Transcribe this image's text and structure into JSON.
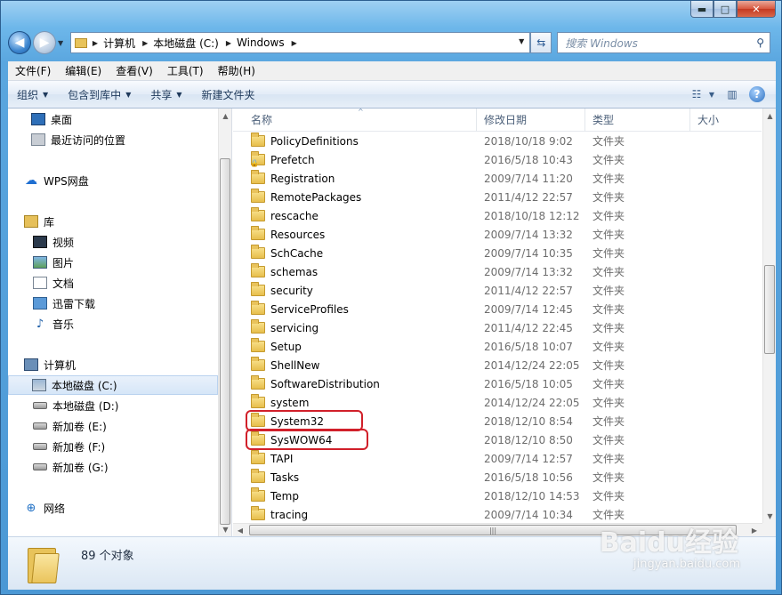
{
  "caption": {
    "minimize": "▬",
    "maximize": "□",
    "close": "✕"
  },
  "address": {
    "crumbs": [
      "计算机",
      "本地磁盘 (C:)",
      "Windows"
    ]
  },
  "search": {
    "placeholder": "搜索 Windows"
  },
  "menu": [
    "文件(F)",
    "编辑(E)",
    "查看(V)",
    "工具(T)",
    "帮助(H)"
  ],
  "toolbar": {
    "organize": "组织",
    "include_library": "包含到库中",
    "share": "共享",
    "new_folder": "新建文件夹"
  },
  "nav": {
    "desktop": "桌面",
    "recent": "最近访问的位置",
    "wps_cloud": "WPS网盘",
    "libraries": "库",
    "videos": "视频",
    "pictures": "图片",
    "documents": "文档",
    "thunder_downloads": "迅雷下载",
    "music": "音乐",
    "computer": "计算机",
    "drive_c": "本地磁盘 (C:)",
    "drive_d": "本地磁盘 (D:)",
    "drive_e": "新加卷 (E:)",
    "drive_f": "新加卷 (F:)",
    "drive_g": "新加卷 (G:)",
    "network": "网络"
  },
  "columns": {
    "name": "名称",
    "date": "修改日期",
    "type": "类型",
    "size": "大小"
  },
  "files": [
    {
      "name": "PolicyDefinitions",
      "date": "2018/10/18 9:02",
      "type": "文件夹"
    },
    {
      "name": "Prefetch",
      "date": "2016/5/18 10:43",
      "type": "文件夹",
      "locked": true
    },
    {
      "name": "Registration",
      "date": "2009/7/14 11:20",
      "type": "文件夹"
    },
    {
      "name": "RemotePackages",
      "date": "2011/4/12 22:57",
      "type": "文件夹"
    },
    {
      "name": "rescache",
      "date": "2018/10/18 12:12",
      "type": "文件夹"
    },
    {
      "name": "Resources",
      "date": "2009/7/14 13:32",
      "type": "文件夹"
    },
    {
      "name": "SchCache",
      "date": "2009/7/14 10:35",
      "type": "文件夹"
    },
    {
      "name": "schemas",
      "date": "2009/7/14 13:32",
      "type": "文件夹"
    },
    {
      "name": "security",
      "date": "2011/4/12 22:57",
      "type": "文件夹"
    },
    {
      "name": "ServiceProfiles",
      "date": "2009/7/14 12:45",
      "type": "文件夹"
    },
    {
      "name": "servicing",
      "date": "2011/4/12 22:45",
      "type": "文件夹"
    },
    {
      "name": "Setup",
      "date": "2016/5/18 10:07",
      "type": "文件夹"
    },
    {
      "name": "ShellNew",
      "date": "2014/12/24 22:05",
      "type": "文件夹"
    },
    {
      "name": "SoftwareDistribution",
      "date": "2016/5/18 10:05",
      "type": "文件夹"
    },
    {
      "name": "system",
      "date": "2014/12/24 22:05",
      "type": "文件夹"
    },
    {
      "name": "System32",
      "date": "2018/12/10 8:54",
      "type": "文件夹",
      "highlighted": true
    },
    {
      "name": "SysWOW64",
      "date": "2018/12/10 8:50",
      "type": "文件夹",
      "highlighted": true
    },
    {
      "name": "TAPI",
      "date": "2009/7/14 12:57",
      "type": "文件夹"
    },
    {
      "name": "Tasks",
      "date": "2016/5/18 10:56",
      "type": "文件夹"
    },
    {
      "name": "Temp",
      "date": "2018/12/10 14:53",
      "type": "文件夹"
    },
    {
      "name": "tracing",
      "date": "2009/7/14 10:34",
      "type": "文件夹"
    }
  ],
  "details": {
    "count": "89 个对象"
  },
  "watermark": {
    "brand": "Baidu经验",
    "url": "jingyan.baidu.com"
  },
  "colors": {
    "highlight": "#d1202a",
    "frame": "#5aa6df"
  }
}
